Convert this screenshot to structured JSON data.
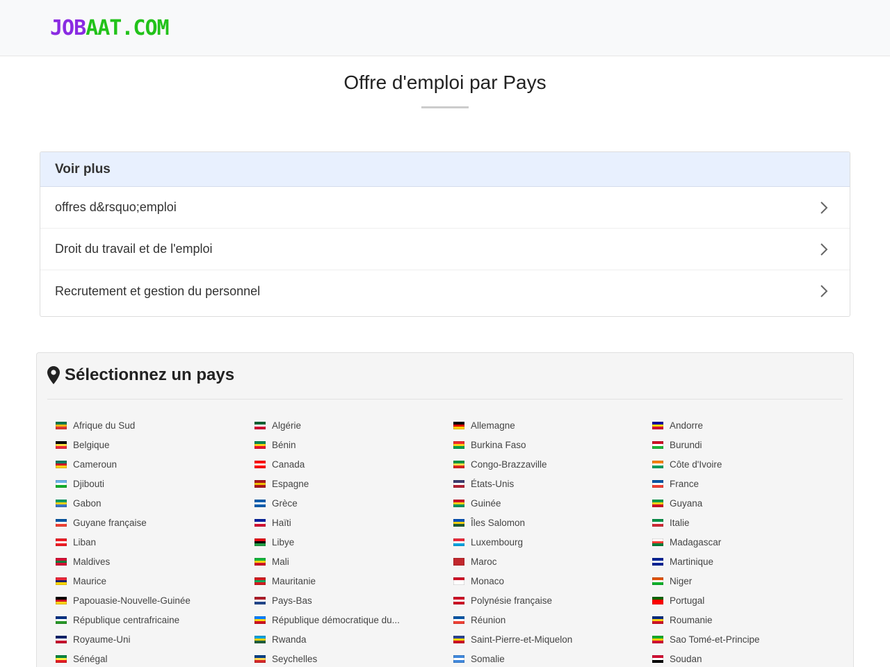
{
  "header": {
    "logo_part1": "JOB",
    "logo_part2": "AAT.COM"
  },
  "page": {
    "title": "Offre d'emploi par Pays"
  },
  "voir_plus": {
    "title": "Voir plus",
    "items": [
      {
        "label": "offres d&rsquo;emploi"
      },
      {
        "label": "Droit du travail et de l'emploi"
      },
      {
        "label": "Recrutement et gestion du personnel"
      }
    ]
  },
  "countries": {
    "title": "Sélectionnez un pays",
    "items": [
      {
        "name": "Afrique du Sud",
        "flag": [
          "#007a4d",
          "#ffb612",
          "#de3831"
        ]
      },
      {
        "name": "Algérie",
        "flag": [
          "#006233",
          "#ffffff",
          "#d21034"
        ]
      },
      {
        "name": "Allemagne",
        "flag": [
          "#000000",
          "#dd0000",
          "#ffce00"
        ]
      },
      {
        "name": "Andorre",
        "flag": [
          "#10069f",
          "#fedf00",
          "#d50032"
        ]
      },
      {
        "name": "Belgique",
        "flag": [
          "#000000",
          "#fae042",
          "#ed2939"
        ]
      },
      {
        "name": "Bénin",
        "flag": [
          "#008751",
          "#fcd116",
          "#e8112d"
        ]
      },
      {
        "name": "Burkina Faso",
        "flag": [
          "#ef2b2d",
          "#fcd116",
          "#009e49"
        ]
      },
      {
        "name": "Burundi",
        "flag": [
          "#ce1126",
          "#ffffff",
          "#1eb53a"
        ]
      },
      {
        "name": "Cameroun",
        "flag": [
          "#007a5e",
          "#ce1126",
          "#fcd116"
        ]
      },
      {
        "name": "Canada",
        "flag": [
          "#ff0000",
          "#ffffff",
          "#ff0000"
        ]
      },
      {
        "name": "Congo-Brazzaville",
        "flag": [
          "#009543",
          "#fbde4a",
          "#dc241f"
        ]
      },
      {
        "name": "Côte d'Ivoire",
        "flag": [
          "#f77f00",
          "#ffffff",
          "#009e60"
        ]
      },
      {
        "name": "Djibouti",
        "flag": [
          "#6ab2e7",
          "#ffffff",
          "#12ad2b"
        ]
      },
      {
        "name": "Espagne",
        "flag": [
          "#aa151b",
          "#f1bf00",
          "#aa151b"
        ]
      },
      {
        "name": "États-Unis",
        "flag": [
          "#3c3b6e",
          "#ffffff",
          "#b22234"
        ]
      },
      {
        "name": "France",
        "flag": [
          "#0055a4",
          "#ffffff",
          "#ef4135"
        ]
      },
      {
        "name": "Gabon",
        "flag": [
          "#009e60",
          "#fcd116",
          "#3a75c4"
        ]
      },
      {
        "name": "Grèce",
        "flag": [
          "#0d5eaf",
          "#ffffff",
          "#0d5eaf"
        ]
      },
      {
        "name": "Guinée",
        "flag": [
          "#ce1126",
          "#fcd116",
          "#009460"
        ]
      },
      {
        "name": "Guyana",
        "flag": [
          "#009e49",
          "#fcd116",
          "#ce1126"
        ]
      },
      {
        "name": "Guyane française",
        "flag": [
          "#0055a4",
          "#ffffff",
          "#ef4135"
        ]
      },
      {
        "name": "Haïti",
        "flag": [
          "#00209f",
          "#ffffff",
          "#d21034"
        ]
      },
      {
        "name": "Îles Salomon",
        "flag": [
          "#0051ba",
          "#fcd116",
          "#215b33"
        ]
      },
      {
        "name": "Italie",
        "flag": [
          "#009246",
          "#ffffff",
          "#ce2b37"
        ]
      },
      {
        "name": "Liban",
        "flag": [
          "#ed1c24",
          "#ffffff",
          "#ed1c24"
        ]
      },
      {
        "name": "Libye",
        "flag": [
          "#e70013",
          "#000000",
          "#239e46"
        ]
      },
      {
        "name": "Luxembourg",
        "flag": [
          "#ed2939",
          "#ffffff",
          "#00a1de"
        ]
      },
      {
        "name": "Madagascar",
        "flag": [
          "#ffffff",
          "#fc3d32",
          "#007e3a"
        ]
      },
      {
        "name": "Maldives",
        "flag": [
          "#d21034",
          "#007e3a",
          "#d21034"
        ]
      },
      {
        "name": "Mali",
        "flag": [
          "#14b53a",
          "#fcd116",
          "#ce1126"
        ]
      },
      {
        "name": "Maroc",
        "flag": [
          "#c1272d",
          "#c1272d",
          "#c1272d"
        ]
      },
      {
        "name": "Martinique",
        "flag": [
          "#002395",
          "#ffffff",
          "#002395"
        ]
      },
      {
        "name": "Maurice",
        "flag": [
          "#ea2839",
          "#1a206d",
          "#ffd500"
        ]
      },
      {
        "name": "Mauritanie",
        "flag": [
          "#d01c1f",
          "#00a95c",
          "#d01c1f"
        ]
      },
      {
        "name": "Monaco",
        "flag": [
          "#ce1126",
          "#ffffff",
          "#ffffff"
        ]
      },
      {
        "name": "Niger",
        "flag": [
          "#e05206",
          "#ffffff",
          "#0db02b"
        ]
      },
      {
        "name": "Papouasie-Nouvelle-Guinée",
        "flag": [
          "#000000",
          "#ce1126",
          "#fcd116"
        ]
      },
      {
        "name": "Pays-Bas",
        "flag": [
          "#ae1c28",
          "#ffffff",
          "#21468b"
        ]
      },
      {
        "name": "Polynésie française",
        "flag": [
          "#ce1126",
          "#ffffff",
          "#ce1126"
        ]
      },
      {
        "name": "Portugal",
        "flag": [
          "#006600",
          "#ff0000",
          "#ff0000"
        ]
      },
      {
        "name": "République centrafricaine",
        "flag": [
          "#003082",
          "#ffffff",
          "#289728"
        ]
      },
      {
        "name": "République démocratique du...",
        "flag": [
          "#007fff",
          "#f7d618",
          "#ce1021"
        ]
      },
      {
        "name": "Réunion",
        "flag": [
          "#0055a4",
          "#ffffff",
          "#ef4135"
        ]
      },
      {
        "name": "Roumanie",
        "flag": [
          "#002b7f",
          "#fcd116",
          "#ce1126"
        ]
      },
      {
        "name": "Royaume-Uni",
        "flag": [
          "#012169",
          "#ffffff",
          "#c8102e"
        ]
      },
      {
        "name": "Rwanda",
        "flag": [
          "#00a1de",
          "#fad201",
          "#20603d"
        ]
      },
      {
        "name": "Saint-Pierre-et-Miquelon",
        "flag": [
          "#2a4494",
          "#ffd700",
          "#ce1126"
        ]
      },
      {
        "name": "Sao Tomé-et-Principe",
        "flag": [
          "#12ad2b",
          "#ffce00",
          "#d21034"
        ]
      },
      {
        "name": "Sénégal",
        "flag": [
          "#00853f",
          "#fdef42",
          "#e31b23"
        ]
      },
      {
        "name": "Seychelles",
        "flag": [
          "#003f87",
          "#fcd856",
          "#d62828"
        ]
      },
      {
        "name": "Somalie",
        "flag": [
          "#4189dd",
          "#ffffff",
          "#4189dd"
        ]
      },
      {
        "name": "Soudan",
        "flag": [
          "#d21034",
          "#ffffff",
          "#000000"
        ]
      }
    ]
  },
  "icons": {
    "chevron": "chevron-right-icon",
    "pin": "map-marker-icon",
    "flag": "flag-icon"
  },
  "colors": {
    "logo_purple": "#8a2be2",
    "logo_green": "#22c21a",
    "voir_header_bg": "#e8f0fe",
    "country_card_bg": "#f5f5f5"
  }
}
